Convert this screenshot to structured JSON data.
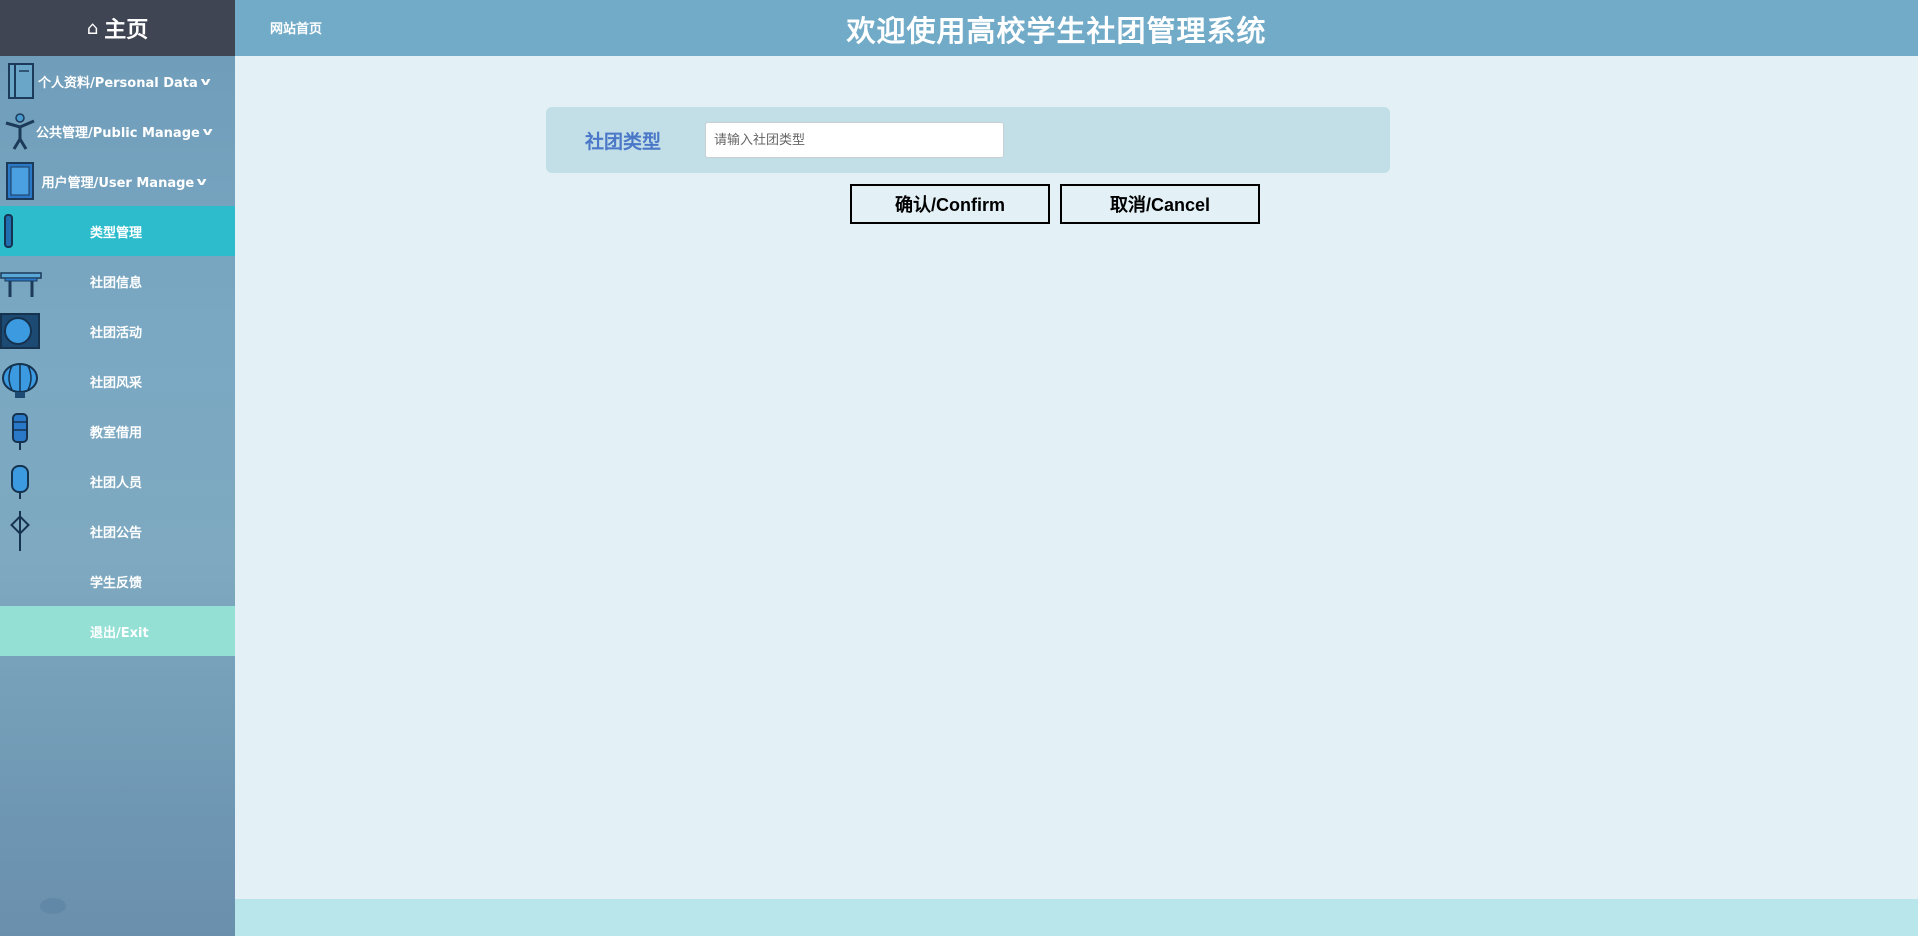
{
  "sidebar": {
    "home_icon": "⌂",
    "home_label": "主页",
    "groups": [
      {
        "label": "个人资料/Personal Data",
        "icon": "book-icon"
      },
      {
        "label": "公共管理/Public Manage",
        "icon": "figure-icon"
      },
      {
        "label": "用户管理/User Manage",
        "icon": "panel-icon"
      }
    ],
    "chevron": "v",
    "items": [
      {
        "label": "类型管理",
        "icon": "scroll-icon",
        "active": true
      },
      {
        "label": "社团信息",
        "icon": "gate-icon"
      },
      {
        "label": "社团活动",
        "icon": "circle-screen-icon"
      },
      {
        "label": "社团风采",
        "icon": "lantern-icon"
      },
      {
        "label": "教室借用",
        "icon": "tall-lantern-icon"
      },
      {
        "label": "社团人员",
        "icon": "small-lantern-icon"
      },
      {
        "label": "社团公告",
        "icon": "knot-icon"
      },
      {
        "label": "学生反馈",
        "icon": ""
      },
      {
        "label": "退出/Exit",
        "icon": ""
      }
    ]
  },
  "header": {
    "site_home": "网站首页",
    "title": "欢迎使用高校学生社团管理系统"
  },
  "form": {
    "field_label": "社团类型",
    "input_value": "",
    "input_placeholder": "请输入社团类型",
    "confirm_label": "确认/Confirm",
    "cancel_label": "取消/Cancel"
  },
  "colors": {
    "header_bg": "#71abc8",
    "home_bg": "#3f4552",
    "active_item": "#2cbccc",
    "exit_item": "#94e0d4",
    "label_color": "#4b77c8"
  }
}
